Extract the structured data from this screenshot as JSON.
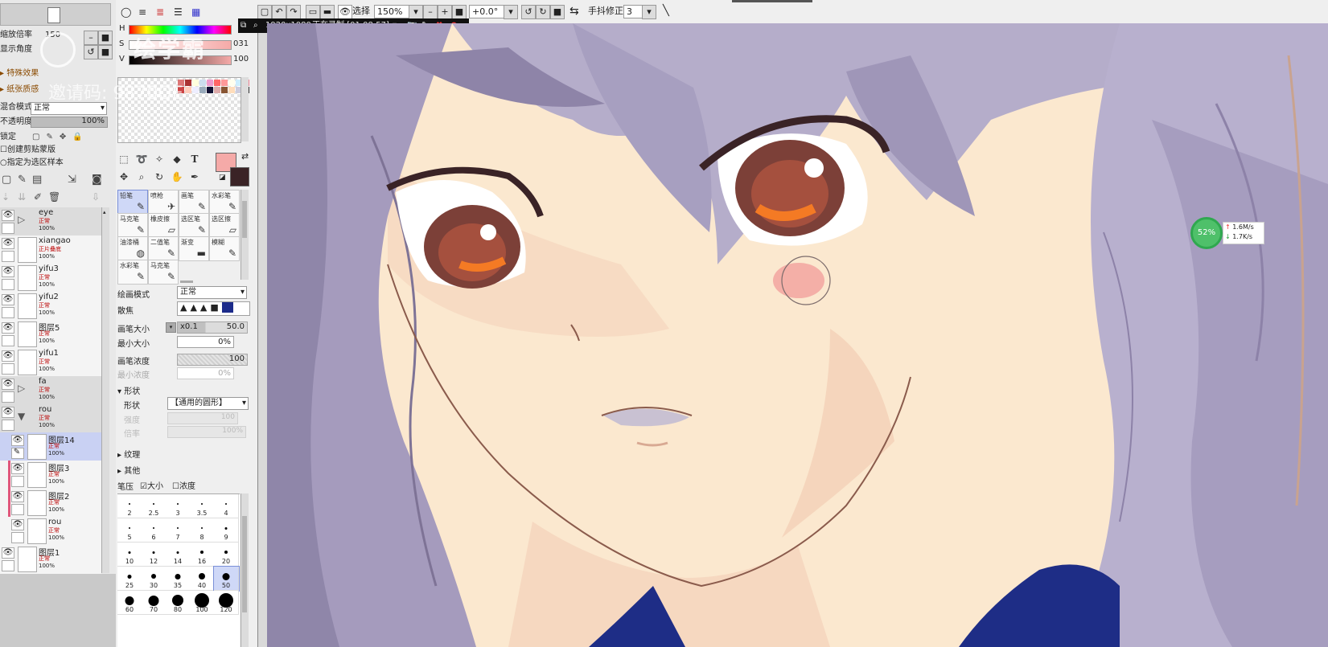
{
  "left_panel": {
    "zoom_label": "缩放倍率",
    "zoom_value": "150",
    "rotate_label": "显示角度",
    "special_effects": "特殊效果",
    "paper_texture": "纸张质感",
    "blend_mode_label": "混合模式",
    "blend_mode_value": "正常",
    "opacity_label": "不透明度",
    "opacity_value": "100%",
    "lock_label": "锁定",
    "clipping_label": "创建剪贴蒙版",
    "selection_source_label": "指定为选区样本",
    "layers": [
      {
        "name": "eye",
        "mode": "正常",
        "opacity": "100%",
        "type": "folder"
      },
      {
        "name": "xiangao",
        "mode": "正片叠底",
        "opacity": "100%",
        "type": "layer"
      },
      {
        "name": "yifu3",
        "mode": "正常",
        "opacity": "100%",
        "type": "layer"
      },
      {
        "name": "yifu2",
        "mode": "正常",
        "opacity": "100%",
        "type": "layer"
      },
      {
        "name": "图层5",
        "mode": "正常",
        "opacity": "100%",
        "type": "layer"
      },
      {
        "name": "yifu1",
        "mode": "正常",
        "opacity": "100%",
        "type": "layer"
      },
      {
        "name": "fa",
        "mode": "正常",
        "opacity": "100%",
        "type": "folder"
      },
      {
        "name": "rou",
        "mode": "正常",
        "opacity": "100%",
        "type": "folder-open"
      },
      {
        "name": "图层14",
        "mode": "正常",
        "opacity": "100%",
        "type": "active"
      },
      {
        "name": "图层3",
        "mode": "正常",
        "opacity": "100%",
        "type": "clip"
      },
      {
        "name": "图层2",
        "mode": "正常",
        "opacity": "100%",
        "type": "clip"
      },
      {
        "name": "rou",
        "mode": "正常",
        "opacity": "100%",
        "type": "layer"
      },
      {
        "name": "图层1",
        "mode": "正常",
        "opacity": "100%",
        "type": "layer"
      }
    ]
  },
  "color_panel": {
    "h_label": "H",
    "s_label": "S",
    "v_label": "V",
    "h_value": "",
    "s_value": "031",
    "v_value": "100",
    "primary_color": "#f5aaa8",
    "secondary_color": "#3a2326"
  },
  "watermark": {
    "logo_text": "绘学霸",
    "invite_text": "邀请码: 9870QE"
  },
  "brushes": [
    {
      "label": "铅笔",
      "icon": "✎"
    },
    {
      "label": "喷枪",
      "icon": "✈"
    },
    {
      "label": "画笔",
      "icon": "✎"
    },
    {
      "label": "水彩笔",
      "icon": "✎"
    },
    {
      "label": "马克笔",
      "icon": "✎"
    },
    {
      "label": "橡皮擦",
      "icon": "▱"
    },
    {
      "label": "选区笔",
      "icon": "✎"
    },
    {
      "label": "选区擦",
      "icon": "▱"
    },
    {
      "label": "油漆桶",
      "icon": "◍"
    },
    {
      "label": "二值笔",
      "icon": "✎"
    },
    {
      "label": "渐变",
      "icon": "▬"
    },
    {
      "label": "模糊",
      "icon": "✎"
    },
    {
      "label": "水彩笔",
      "icon": "✎"
    },
    {
      "label": "马克笔",
      "icon": "✎"
    }
  ],
  "brush_settings": {
    "draw_mode_label": "绘画模式",
    "draw_mode_value": "正常",
    "blur_label": "散焦",
    "size_label": "画笔大小",
    "size_mult": "x0.1",
    "size_value": "50.0",
    "min_size_label": "最小大小",
    "min_size_value": "0%",
    "density_label": "画笔浓度",
    "density_value": "100",
    "min_density_label": "最小浓度",
    "min_density_value": "0%",
    "shape_section": "形状",
    "shape_label": "形状",
    "shape_value": "【通用的圆形】",
    "strength_label": "强度",
    "strength_value": "100",
    "scale_label": "倍率",
    "scale_value": "100%",
    "texture_section": "纹理",
    "other_section": "其他",
    "pressure_label": "笔压",
    "pressure_size_label": "大小",
    "pressure_density_label": "浓度",
    "pressure_size_checked": true,
    "pressure_density_checked": false
  },
  "brush_sizes": [
    "2",
    "2.5",
    "3",
    "3.5",
    "4",
    "5",
    "6",
    "7",
    "8",
    "9",
    "10",
    "12",
    "14",
    "16",
    "20",
    "25",
    "30",
    "35",
    "40",
    "50",
    "60",
    "70",
    "80",
    "100",
    "120"
  ],
  "selected_brush_size": "50",
  "toolbar": {
    "selection_label": "选择",
    "zoom_value": "150%",
    "rotation_value": "+0.0°",
    "stabilizer_label": "手抖修正",
    "stabilizer_value": "3"
  },
  "recorder": {
    "resolution": "1920x1080",
    "status": "正在录制 [01:08:57]"
  },
  "network_widget": {
    "cpu_percent": "52%",
    "upload": "1.6M/s",
    "download": "1.7K/s",
    "ring_color": "#2fa84f"
  }
}
